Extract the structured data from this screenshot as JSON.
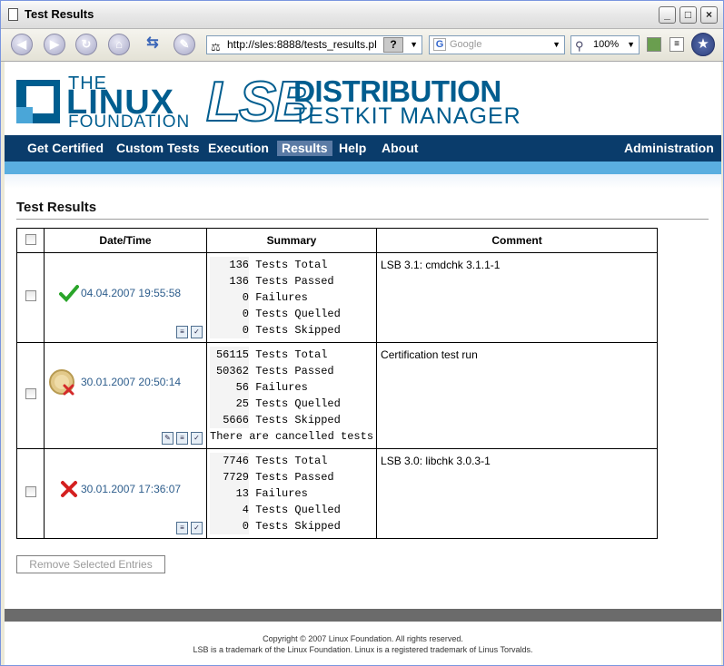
{
  "window": {
    "title": "Test Results",
    "controls": [
      "_",
      "□",
      "×"
    ]
  },
  "browser": {
    "url": "http://sles:8888/tests_results.pl",
    "help_label": "?",
    "search_placeholder": "Google",
    "zoom": "100%"
  },
  "logo": {
    "the": "THE",
    "linux": "LINUX",
    "foundation": "FOUNDATION",
    "lsb": "LSB",
    "distribution": "DISTRIBUTION",
    "testkit_manager": "TESTKIT MANAGER"
  },
  "nav": {
    "items": [
      {
        "label": "Get Certified"
      },
      {
        "label": "Custom Tests"
      },
      {
        "label": "Execution"
      },
      {
        "label": "Results"
      },
      {
        "label": "Help"
      },
      {
        "label": "About"
      }
    ],
    "admin": "Administration"
  },
  "main": {
    "heading": "Test Results",
    "columns": [
      "Date/Time",
      "Summary",
      "Comment"
    ],
    "rows": [
      {
        "status": "passed",
        "datetime": "04.04.2007 19:55:58",
        "summary": [
          {
            "n": "136",
            "t": "Tests Total"
          },
          {
            "n": "136",
            "t": "Tests Passed"
          },
          {
            "n": "0",
            "t": "Failures"
          },
          {
            "n": "0",
            "t": "Tests Quelled"
          },
          {
            "n": "0",
            "t": "Tests Skipped"
          }
        ],
        "note": "",
        "comment": "LSB 3.1: cmdchk 3.1.1-1"
      },
      {
        "status": "certification-failed",
        "datetime": "30.01.2007 20:50:14",
        "summary": [
          {
            "n": "56115",
            "t": "Tests Total"
          },
          {
            "n": "50362",
            "t": "Tests Passed"
          },
          {
            "n": "56",
            "t": "Failures"
          },
          {
            "n": "25",
            "t": "Tests Quelled"
          },
          {
            "n": "5666",
            "t": "Tests Skipped"
          }
        ],
        "note": "There are cancelled tests",
        "comment": "Certification test run"
      },
      {
        "status": "failed",
        "datetime": "30.01.2007 17:36:07",
        "summary": [
          {
            "n": "7746",
            "t": "Tests Total"
          },
          {
            "n": "7729",
            "t": "Tests Passed"
          },
          {
            "n": "13",
            "t": "Failures"
          },
          {
            "n": "4",
            "t": "Tests Quelled"
          },
          {
            "n": "0",
            "t": "Tests Skipped"
          }
        ],
        "note": "",
        "comment": "LSB 3.0: libchk 3.0.3-1"
      }
    ],
    "remove_button": "Remove Selected Entries"
  },
  "footer": {
    "copyright": "Copyright © 2007 Linux Foundation. All rights reserved.",
    "trademark": "LSB is a trademark of the Linux Foundation. Linux is a registered trademark of Linus Torvalds."
  },
  "colors": {
    "nav_bg": "#0a3c6b",
    "accent": "#5aaee0",
    "brand": "#005d8f",
    "link": "#2d5d8c"
  },
  "icons": {
    "passed": "checkmark-icon",
    "certification-failed": "medal-x-icon",
    "failed": "red-x-icon"
  }
}
